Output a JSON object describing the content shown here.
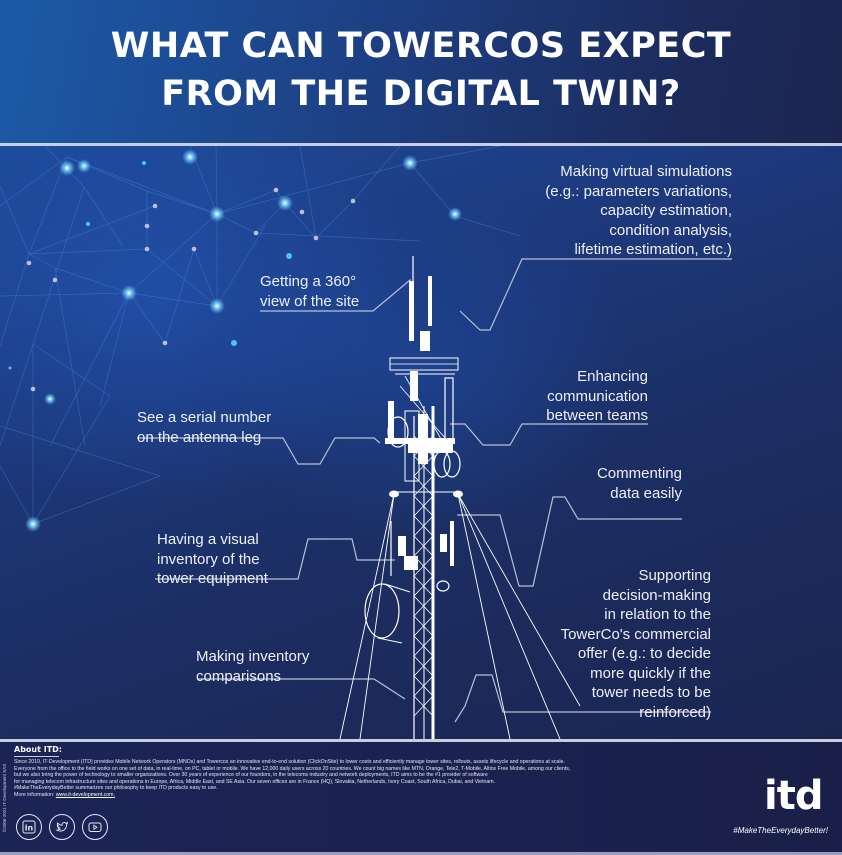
{
  "header": {
    "title_line1": "WHAT CAN TOWERCOS EXPECT",
    "title_line2": "FROM THE DIGITAL TWIN?"
  },
  "features": [
    {
      "id": "virtual-simulations",
      "text": "Making virtual simulations\n(e.g.: parameters variations,\ncapacity estimation,\ncondition analysis,\nlifetime estimation, etc.)",
      "side": "right"
    },
    {
      "id": "360-view",
      "text": "Getting a 360°\nview of the site",
      "side": "left"
    },
    {
      "id": "enhancing-communication",
      "text": "Enhancing\ncommunication\nbetween teams",
      "side": "right"
    },
    {
      "id": "serial-number",
      "text": "See a serial number\non the antenna leg",
      "side": "left"
    },
    {
      "id": "commenting-data",
      "text": "Commenting\ndata easily",
      "side": "right"
    },
    {
      "id": "visual-inventory",
      "text": "Having a visual\ninventory of the\ntower equipment",
      "side": "left"
    },
    {
      "id": "decision-making",
      "text": "Supporting\ndecision-making\nin relation to the\nTowerCo's commercial\noffer (e.g.: to decide\nmore quickly if the\ntower needs to be\nreinforced)",
      "side": "right"
    },
    {
      "id": "inventory-comparisons",
      "text": "Making inventory\ncomparisons",
      "side": "left"
    }
  ],
  "footer": {
    "about_title": "About ITD:",
    "about_lines": [
      "Since 2010, IT-Development (ITD) provides Mobile Network Operators (MNOs) and Towercos an innovative end-to-end solution (ClickOnSite) to lower costs and efficiently manage tower sites, rollouts, assets lifecycle and  operations at scale.",
      "Everyone from the office to the field works on one set of data, in real-time, on PC, tablet or mobile. We have 12,000 daily users across 20 countries. We count big names like MTN, Orange, Tele2, T-Mobile, Altice Free Mobile,  among our clients,",
      "but we also bring the power of technology to smaller organizations. Over 30 years of experience of our founders, in the telecoms industry and network deployments, ITD aims to be the #1 provider of software",
      "for managing telecom infrastructure sites and operations in Europe, Africa, Middle East, and SE Asia.  Our seven offices are in France (HQ), Slovakia, Netherlands, Ivory Coast, South Africa, Dubai, and Vietnam.",
      "#MakeTheEverydayBetter summarizes our philosophy to keep ITD products easy to use."
    ],
    "more_info_label": "More information: ",
    "more_info_link": "www.it-development.com.",
    "copyright": "©2006-2021 IT-Development SAS",
    "social": [
      {
        "name": "linkedin",
        "icon": "linkedin-icon"
      },
      {
        "name": "twitter",
        "icon": "twitter-icon"
      },
      {
        "name": "youtube",
        "icon": "youtube-icon"
      }
    ],
    "logo": "itd",
    "tagline": "#MakeTheEverydayBetter!"
  },
  "colors": {
    "header_start": "#1c5aa8",
    "header_end": "#1c2550",
    "background": "#1b2550",
    "line": "#c9cde0",
    "node_glow": "#4fc3ff"
  }
}
